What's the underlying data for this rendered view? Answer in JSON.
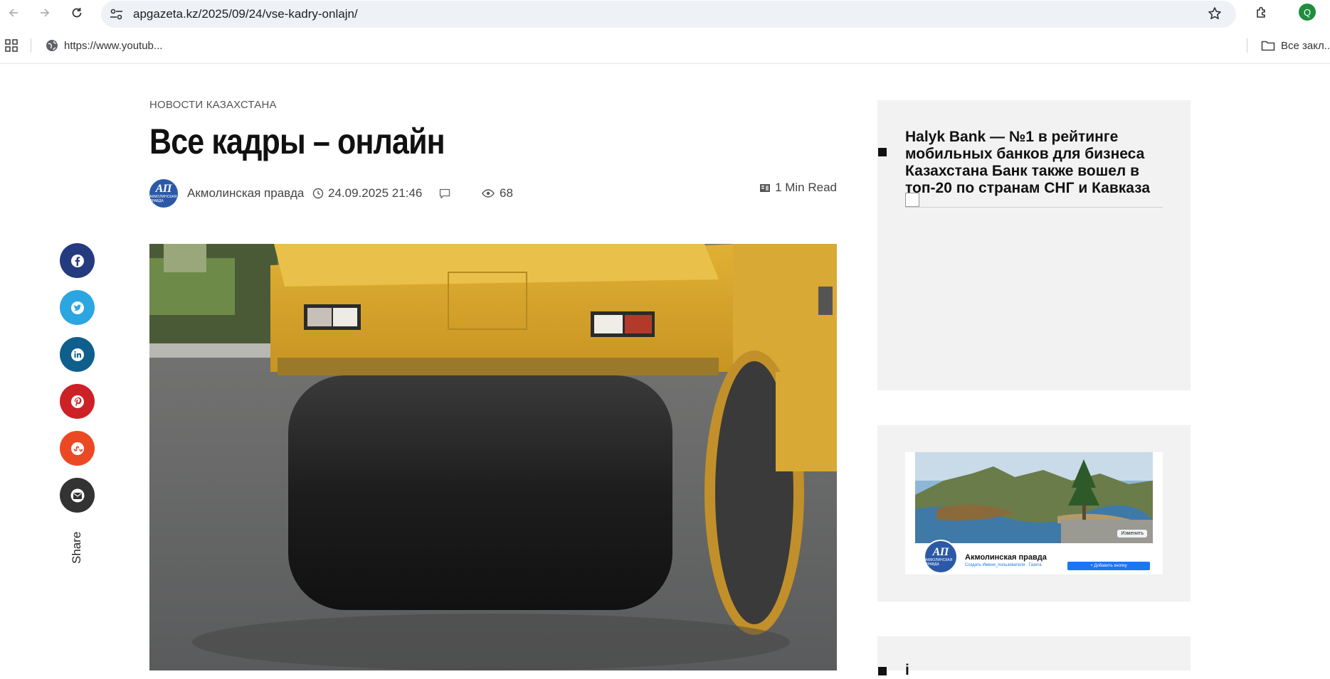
{
  "browser": {
    "url": "apgazeta.kz/2025/09/24/vse-kadry-onlajn/",
    "profile_initial": "Q",
    "bookmarks": [
      {
        "label": "https://www.youtub..."
      }
    ],
    "bookmarks_folder": "Все закл..."
  },
  "article": {
    "category": "НОВОСТИ КАЗАХСТАНА",
    "title": "Все кадры – онлайн",
    "author": "Акмолинская правда",
    "author_avatar_text": "АП",
    "author_avatar_subtext": "АКМОЛИНСКАЯ ПРАВДА",
    "date": "24.09.2025 21:46",
    "views": "68",
    "read_time": "1 Min Read",
    "hero_description": "photo of a yellow road roller on fresh asphalt"
  },
  "share": {
    "label": "Share",
    "buttons": [
      {
        "name": "facebook",
        "color": "#253b80"
      },
      {
        "name": "twitter",
        "color": "#2ba6e1"
      },
      {
        "name": "linkedin",
        "color": "#0e5f8c"
      },
      {
        "name": "pinterest",
        "color": "#cc2127"
      },
      {
        "name": "stumbleupon",
        "color": "#eb4924"
      },
      {
        "name": "email",
        "color": "#333333"
      }
    ]
  },
  "sidebar": {
    "ad_title": "Halyk Bank — №1 в рейтинге мобильных банков для бизнеса Казахстана Банк также вошел в топ-20 по странам СНГ и Кавказа",
    "fb_page_name": "Акмолинская правда",
    "fb_page_sub": "Создать Имени_пользователя · Газета",
    "fb_edit_label": "Изменить",
    "fb_add_button": "+ Добавить кнопку",
    "widget3_text": "i"
  },
  "colors": {
    "accent_green": "#1e8e3e",
    "widget_bg": "#f2f2f2",
    "facebook_blue": "#1877f2"
  }
}
